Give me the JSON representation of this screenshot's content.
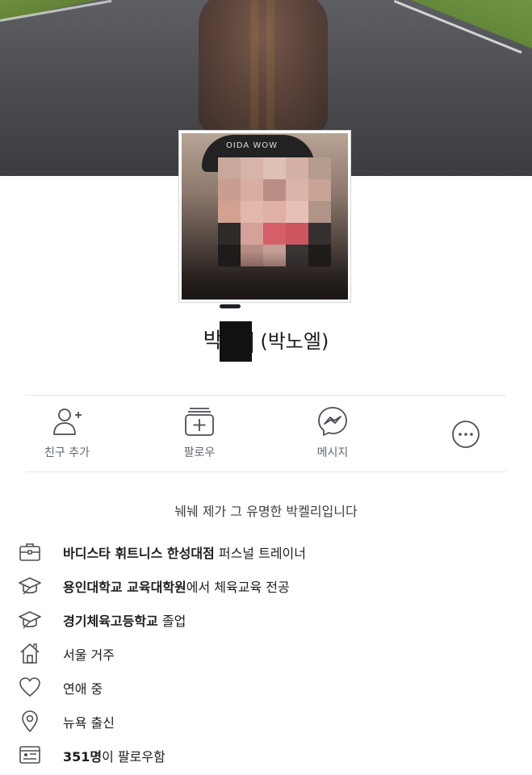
{
  "profile": {
    "name_visible_start": "박",
    "name_visible_end": "|",
    "alt_name": "(박노엘)",
    "avatar_hat_text": "OIDA WOW"
  },
  "actions": [
    {
      "label": "친구 추가",
      "icon": "add-friend-icon"
    },
    {
      "label": "팔로우",
      "icon": "follow-icon"
    },
    {
      "label": "메시지",
      "icon": "messenger-icon"
    },
    {
      "label": "",
      "icon": "more-icon"
    }
  ],
  "bio": "눼눼 제가 그 유명한 박켈리입니다",
  "info": [
    {
      "icon": "briefcase-icon",
      "bold": "바디스타 휘트니스 한성대점",
      "rest": " 퍼스널 트레이너"
    },
    {
      "icon": "graduation-cap-icon",
      "bold": "용인대학교 교육대학원",
      "rest": "에서 체육교육 전공"
    },
    {
      "icon": "graduation-cap-icon",
      "bold": "경기체육고등학교",
      "rest": " 졸업"
    },
    {
      "icon": "home-icon",
      "bold": "",
      "rest": "서울 거주"
    },
    {
      "icon": "heart-icon",
      "bold": "",
      "rest": "연애 중"
    },
    {
      "icon": "location-pin-icon",
      "bold": "",
      "rest": "뉴욕 출신"
    },
    {
      "icon": "followers-icon",
      "bold": "351명",
      "rest": "이 팔로우함"
    }
  ],
  "colors": {
    "text": "#1c1e21",
    "secondary": "#606770",
    "icon": "#4b4f56"
  }
}
